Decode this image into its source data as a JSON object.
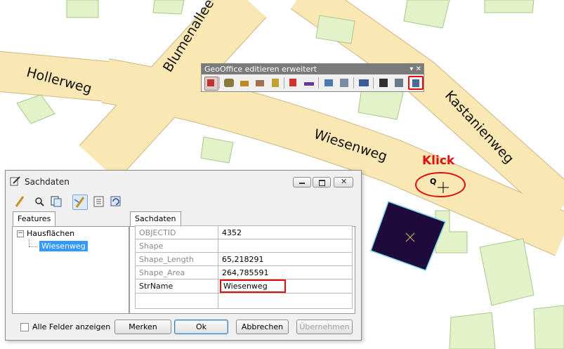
{
  "map": {
    "street_labels": [
      "Blumenallee",
      "Hollerweg",
      "Wiesenweg",
      "Kastanienweg"
    ],
    "annotation": {
      "text": "Klick",
      "color": "#e01010"
    },
    "colors": {
      "road": "#f9e7b4",
      "road_edge": "#cdb784",
      "building": "#e3f2c8",
      "building_edge": "#a8c88a",
      "selection_fill": "#1f0a3c",
      "selection_edge": "#7fd3e6",
      "highlight": "#e01010"
    }
  },
  "toolbar": {
    "title": "GeoOffice editieren erweitert",
    "controls": "▾ ✕"
  },
  "dialog": {
    "title": "Sachdaten",
    "tabs": {
      "left": "Features",
      "right": "Sachdaten"
    },
    "tree": {
      "root": "Hausflächen",
      "child": "Wiesenweg"
    },
    "fields": [
      {
        "name": "OBJECTID",
        "value": "4352"
      },
      {
        "name": "Shape",
        "value": ""
      },
      {
        "name": "Shape_Length",
        "value": "65,218291"
      },
      {
        "name": "Shape_Area",
        "value": "264,785591"
      },
      {
        "name": "StrName",
        "value": "Wiesenweg"
      }
    ],
    "checkbox_label": "Alle Felder anzeigen",
    "buttons": {
      "merken": "Merken",
      "ok": "Ok",
      "abbrechen": "Abbrechen",
      "uebernehmen": "Übernehmen"
    }
  }
}
